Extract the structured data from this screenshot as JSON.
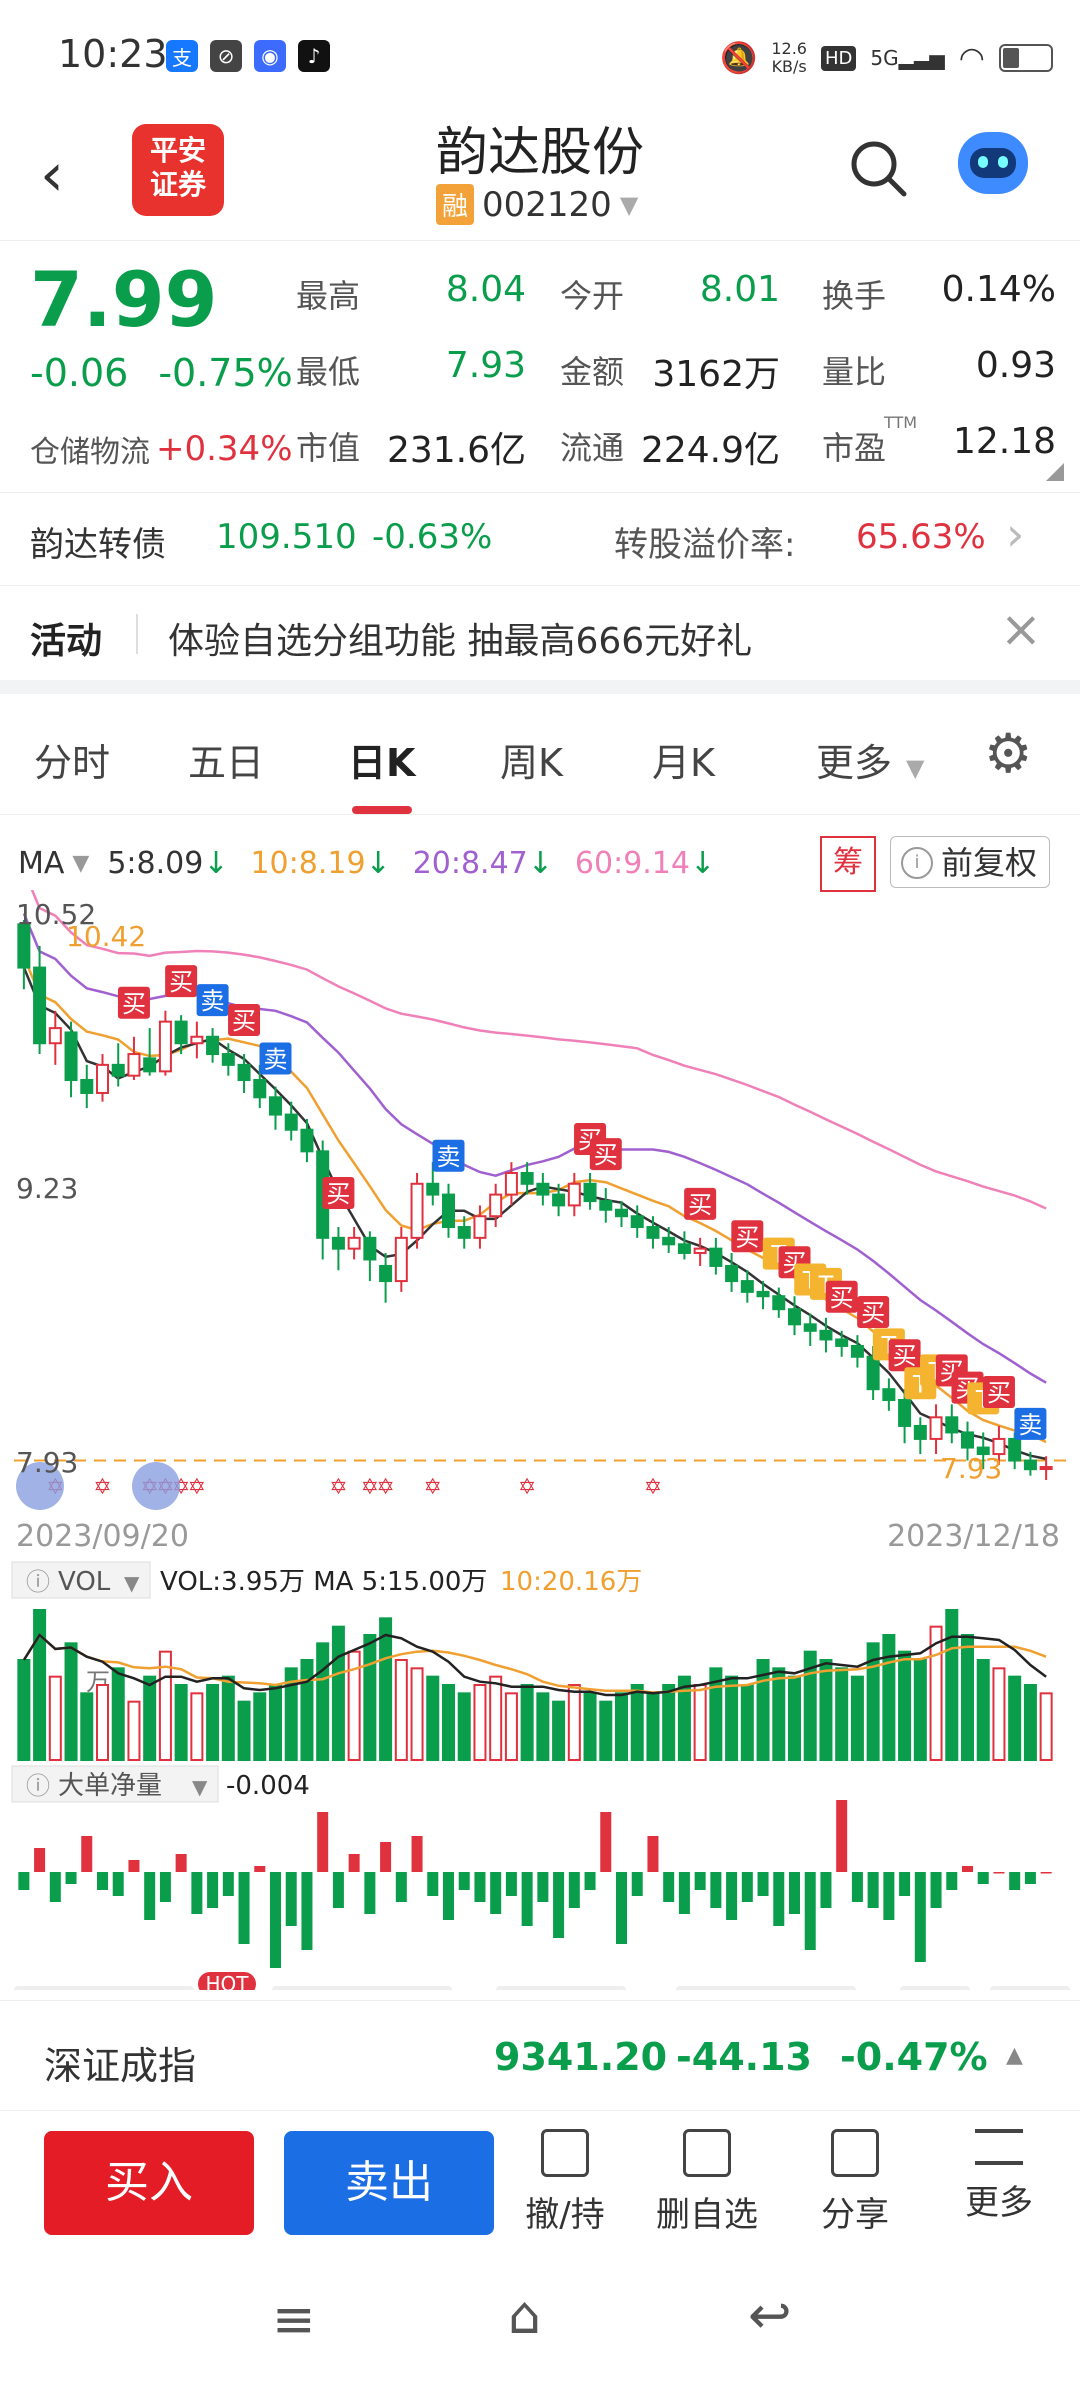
{
  "status_bar": {
    "time": "10:23",
    "app_icons": [
      "alipay-icon",
      "app-icon",
      "chat-icon",
      "tiktok-icon"
    ],
    "net_speed_value": "12.6",
    "net_speed_unit": "KB/s",
    "hd": "HD",
    "network": "5G"
  },
  "header": {
    "logo_text_1": "平安",
    "logo_text_2": "证券",
    "stock_name": "韵达股份",
    "margin_badge": "融",
    "stock_code": "002120"
  },
  "quote": {
    "price": "7.99",
    "change": "-0.06",
    "change_pct": "-0.75%",
    "sector_name": "仓储物流",
    "sector_pct": "+0.34%",
    "cells": [
      {
        "label": "最高",
        "value": "8.04",
        "color": "green"
      },
      {
        "label": "今开",
        "value": "8.01",
        "color": "green"
      },
      {
        "label": "换手",
        "value": "0.14%",
        "color": "black"
      },
      {
        "label": "最低",
        "value": "7.93",
        "color": "green"
      },
      {
        "label": "金额",
        "value": "3162万",
        "color": "black"
      },
      {
        "label": "量比",
        "value": "0.93",
        "color": "black"
      },
      {
        "label": "市值",
        "value": "231.6亿",
        "color": "black"
      },
      {
        "label": "流通",
        "value": "224.9亿",
        "color": "black"
      },
      {
        "label": "市盈",
        "value": "12.18",
        "color": "black"
      }
    ],
    "ttm": "TTM"
  },
  "bond": {
    "name": "韵达转债",
    "price": "109.510",
    "pct": "-0.63%",
    "premium_label": "转股溢价率:",
    "premium_value": "65.63%"
  },
  "activity": {
    "label": "活动",
    "text": "体验自选分组功能 抽最高666元好礼"
  },
  "tabs": [
    "分时",
    "五日",
    "日K",
    "周K",
    "月K",
    "更多"
  ],
  "active_tab": 2,
  "ma": {
    "label": "MA",
    "items": [
      {
        "text": "5:8.09",
        "color": "#333333"
      },
      {
        "text": "10:8.19",
        "color": "#f0a030"
      },
      {
        "text": "20:8.47",
        "color": "#a060d0"
      },
      {
        "text": "60:9.14",
        "color": "#f080b8"
      }
    ],
    "chou": "筹",
    "fuquan": "前复权"
  },
  "chart_data": {
    "type": "candlestick",
    "y_labels": [
      "10.52",
      "9.23",
      "7.93"
    ],
    "high_marker": "10.42",
    "low_marker": "7.93",
    "date_start": "2023/09/20",
    "date_end": "2023/12/18",
    "ylim": [
      7.93,
      10.52
    ],
    "ohlc": [
      [
        10.5,
        10.3,
        10.52,
        10.2
      ],
      [
        10.3,
        9.95,
        10.4,
        9.9
      ],
      [
        9.95,
        10.02,
        10.1,
        9.85
      ],
      [
        10.0,
        9.78,
        10.05,
        9.7
      ],
      [
        9.78,
        9.72,
        9.85,
        9.65
      ],
      [
        9.72,
        9.85,
        9.9,
        9.68
      ],
      [
        9.85,
        9.8,
        9.95,
        9.75
      ],
      [
        9.8,
        9.9,
        9.98,
        9.78
      ],
      [
        9.88,
        9.82,
        10.02,
        9.8
      ],
      [
        9.82,
        10.05,
        10.1,
        9.8
      ],
      [
        10.05,
        9.95,
        10.08,
        9.9
      ],
      [
        9.95,
        9.98,
        10.05,
        9.88
      ],
      [
        9.98,
        9.9,
        10.02,
        9.86
      ],
      [
        9.9,
        9.85,
        9.95,
        9.8
      ],
      [
        9.85,
        9.78,
        9.9,
        9.72
      ],
      [
        9.78,
        9.7,
        9.85,
        9.65
      ],
      [
        9.7,
        9.62,
        9.75,
        9.55
      ],
      [
        9.62,
        9.55,
        9.68,
        9.5
      ],
      [
        9.55,
        9.45,
        9.6,
        9.4
      ],
      [
        9.45,
        9.05,
        9.5,
        8.95
      ],
      [
        9.05,
        9.0,
        9.1,
        8.9
      ],
      [
        9.0,
        9.05,
        9.1,
        8.95
      ],
      [
        9.05,
        8.95,
        9.08,
        8.85
      ],
      [
        8.92,
        8.85,
        8.98,
        8.75
      ],
      [
        8.85,
        9.05,
        9.1,
        8.8
      ],
      [
        9.05,
        9.3,
        9.35,
        9.0
      ],
      [
        9.3,
        9.25,
        9.4,
        9.2
      ],
      [
        9.25,
        9.1,
        9.3,
        9.05
      ],
      [
        9.1,
        9.05,
        9.15,
        9.0
      ],
      [
        9.05,
        9.15,
        9.2,
        9.0
      ],
      [
        9.15,
        9.25,
        9.3,
        9.1
      ],
      [
        9.25,
        9.35,
        9.4,
        9.2
      ],
      [
        9.35,
        9.3,
        9.4,
        9.25
      ],
      [
        9.3,
        9.25,
        9.35,
        9.2
      ],
      [
        9.25,
        9.2,
        9.3,
        9.15
      ],
      [
        9.2,
        9.3,
        9.35,
        9.15
      ],
      [
        9.3,
        9.22,
        9.35,
        9.18
      ],
      [
        9.22,
        9.18,
        9.28,
        9.12
      ],
      [
        9.18,
        9.15,
        9.22,
        9.1
      ],
      [
        9.15,
        9.1,
        9.2,
        9.05
      ],
      [
        9.1,
        9.05,
        9.15,
        9.0
      ],
      [
        9.05,
        9.02,
        9.1,
        8.98
      ],
      [
        9.02,
        8.98,
        9.08,
        8.95
      ],
      [
        8.98,
        9.0,
        9.05,
        8.92
      ],
      [
        9.0,
        8.92,
        9.05,
        8.88
      ],
      [
        8.92,
        8.85,
        8.98,
        8.8
      ],
      [
        8.85,
        8.8,
        8.9,
        8.75
      ],
      [
        8.8,
        8.78,
        8.85,
        8.72
      ],
      [
        8.78,
        8.72,
        8.82,
        8.68
      ],
      [
        8.72,
        8.65,
        8.78,
        8.6
      ],
      [
        8.65,
        8.62,
        8.7,
        8.55
      ],
      [
        8.62,
        8.58,
        8.68,
        8.52
      ],
      [
        8.58,
        8.55,
        8.62,
        8.5
      ],
      [
        8.55,
        8.5,
        8.6,
        8.45
      ],
      [
        8.5,
        8.35,
        8.55,
        8.3
      ],
      [
        8.35,
        8.3,
        8.4,
        8.25
      ],
      [
        8.3,
        8.18,
        8.35,
        8.1
      ],
      [
        8.18,
        8.12,
        8.22,
        8.05
      ],
      [
        8.12,
        8.22,
        8.28,
        8.05
      ],
      [
        8.22,
        8.15,
        8.28,
        8.1
      ],
      [
        8.15,
        8.08,
        8.2,
        8.02
      ],
      [
        8.08,
        8.05,
        8.15,
        7.98
      ],
      [
        8.05,
        8.12,
        8.18,
        8.0
      ],
      [
        8.12,
        8.02,
        8.15,
        7.98
      ],
      [
        8.02,
        7.98,
        8.06,
        7.95
      ],
      [
        7.99,
        7.99,
        8.04,
        7.93
      ]
    ],
    "markers": [
      {
        "i": 7,
        "t": "买",
        "k": "buy"
      },
      {
        "i": 10,
        "t": "买",
        "k": "buy"
      },
      {
        "i": 12,
        "t": "卖",
        "k": "sell"
      },
      {
        "i": 14,
        "t": "买",
        "k": "buy"
      },
      {
        "i": 16,
        "t": "卖",
        "k": "sell"
      },
      {
        "i": 20,
        "t": "买",
        "k": "buy"
      },
      {
        "i": 27,
        "t": "卖",
        "k": "sell"
      },
      {
        "i": 36,
        "t": "买",
        "k": "buy"
      },
      {
        "i": 37,
        "t": "买",
        "k": "buy"
      },
      {
        "i": 43,
        "t": "买",
        "k": "buy"
      },
      {
        "i": 46,
        "t": "买",
        "k": "buy"
      },
      {
        "i": 48,
        "t": "T",
        "k": "t"
      },
      {
        "i": 49,
        "t": "买",
        "k": "buy"
      },
      {
        "i": 50,
        "t": "T",
        "k": "t"
      },
      {
        "i": 51,
        "t": "T",
        "k": "t"
      },
      {
        "i": 52,
        "t": "买",
        "k": "buy"
      },
      {
        "i": 54,
        "t": "买",
        "k": "buy"
      },
      {
        "i": 55,
        "t": "T",
        "k": "t"
      },
      {
        "i": 56,
        "t": "买",
        "k": "buy"
      },
      {
        "i": 57,
        "t": "T",
        "k": "t"
      },
      {
        "i": 58,
        "t": "T",
        "k": "t"
      },
      {
        "i": 59,
        "t": "买",
        "k": "buy"
      },
      {
        "i": 60,
        "t": "买",
        "k": "buy"
      },
      {
        "i": 61,
        "t": "T",
        "k": "t"
      },
      {
        "i": 62,
        "t": "买",
        "k": "buy"
      },
      {
        "i": 64,
        "t": "卖",
        "k": "sell"
      }
    ],
    "vol_label": "VOL",
    "vol_text": "VOL:3.95万 MA 5:15.00万",
    "vol_ma10": "10:20.16万",
    "vol_unit": "万",
    "volumes": [
      12,
      18,
      10,
      14,
      8,
      9,
      11,
      7,
      10,
      13,
      9,
      8,
      9,
      10,
      7,
      8,
      9,
      11,
      12,
      14,
      16,
      13,
      15,
      17,
      12,
      11,
      10,
      9,
      8,
      9,
      10,
      8,
      9,
      8,
      7,
      9,
      8,
      7,
      8,
      9,
      8,
      9,
      10,
      9,
      11,
      10,
      9,
      12,
      11,
      10,
      13,
      12,
      11,
      10,
      14,
      15,
      13,
      12,
      16,
      18,
      15,
      12,
      11,
      10,
      9,
      8
    ],
    "dadan_label": "大单净量",
    "dadan_value": "-0.004",
    "dadan": [
      -0.3,
      0.4,
      -0.5,
      -0.2,
      0.6,
      -0.3,
      -0.4,
      0.2,
      -0.8,
      -0.5,
      0.3,
      -0.7,
      -0.6,
      -0.4,
      -1.2,
      0.1,
      -1.6,
      -0.9,
      -1.3,
      1.0,
      -0.6,
      0.3,
      -0.7,
      0.5,
      -0.5,
      0.6,
      -0.4,
      -0.8,
      -0.3,
      -0.5,
      -0.7,
      -0.4,
      -0.9,
      -0.5,
      -1.1,
      -0.6,
      -0.3,
      1.0,
      -1.2,
      -0.4,
      0.6,
      -0.5,
      -0.7,
      -0.3,
      -0.6,
      -0.8,
      -0.5,
      -0.4,
      -0.9,
      -0.7,
      -1.3,
      -0.6,
      1.2,
      -0.5,
      -0.6,
      -0.8,
      -0.4,
      -1.5,
      -0.6,
      -0.3,
      0.1,
      -0.2,
      0.0,
      -0.3,
      -0.2,
      0.0
    ],
    "hot": "HOT"
  },
  "index_bar": {
    "name": "深证成指",
    "value": "9341.20",
    "change": "-44.13",
    "pct": "-0.47%"
  },
  "actions": {
    "buy": "买入",
    "sell": "卖出",
    "items": [
      "撤/持",
      "删自选",
      "分享",
      "更多"
    ]
  },
  "colors": {
    "up": "#e0313f",
    "down": "#0a9e4c",
    "ma5": "#333333",
    "ma10": "#f0a030",
    "ma20": "#a060d0",
    "ma60": "#f080b8",
    "buy_btn": "#e31c26",
    "sell_btn": "#1b6ee3"
  }
}
